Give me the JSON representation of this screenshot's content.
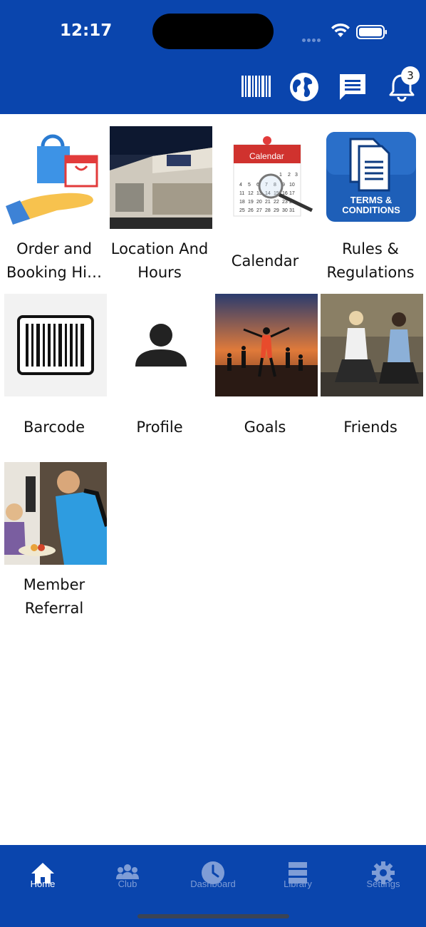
{
  "status_bar": {
    "time": "12:17"
  },
  "header": {
    "icons": [
      "barcode-icon",
      "globe-icon",
      "chat-icon",
      "bell-icon"
    ],
    "notification_count": "3",
    "colors": {
      "brand": "#0a45ad"
    }
  },
  "tiles": [
    {
      "label": "Order and Booking Hi…",
      "icon": "shopping-bag-hand-icon"
    },
    {
      "label": "Location And Hours",
      "icon": "building-photo"
    },
    {
      "label": "Calendar",
      "icon": "calendar-icon",
      "image_text": "Calendar"
    },
    {
      "label": "Rules & Regulations",
      "icon": "terms-icon",
      "image_text": "TERMS & CONDITIONS"
    },
    {
      "label": "Barcode",
      "icon": "barcode-icon"
    },
    {
      "label": "Profile",
      "icon": "person-icon"
    },
    {
      "label": "Goals",
      "icon": "runners-photo"
    },
    {
      "label": "Friends",
      "icon": "gym-friends-photo"
    },
    {
      "label": "Member Referral",
      "icon": "referral-photo"
    }
  ],
  "tabbar": {
    "items": [
      {
        "label": "Home",
        "icon": "home-icon",
        "active": true
      },
      {
        "label": "Club",
        "icon": "group-icon",
        "active": false
      },
      {
        "label": "Dashboard",
        "icon": "clock-icon",
        "active": false
      },
      {
        "label": "Library",
        "icon": "library-icon",
        "active": false
      },
      {
        "label": "Settings",
        "icon": "gear-icon",
        "active": false
      }
    ]
  }
}
